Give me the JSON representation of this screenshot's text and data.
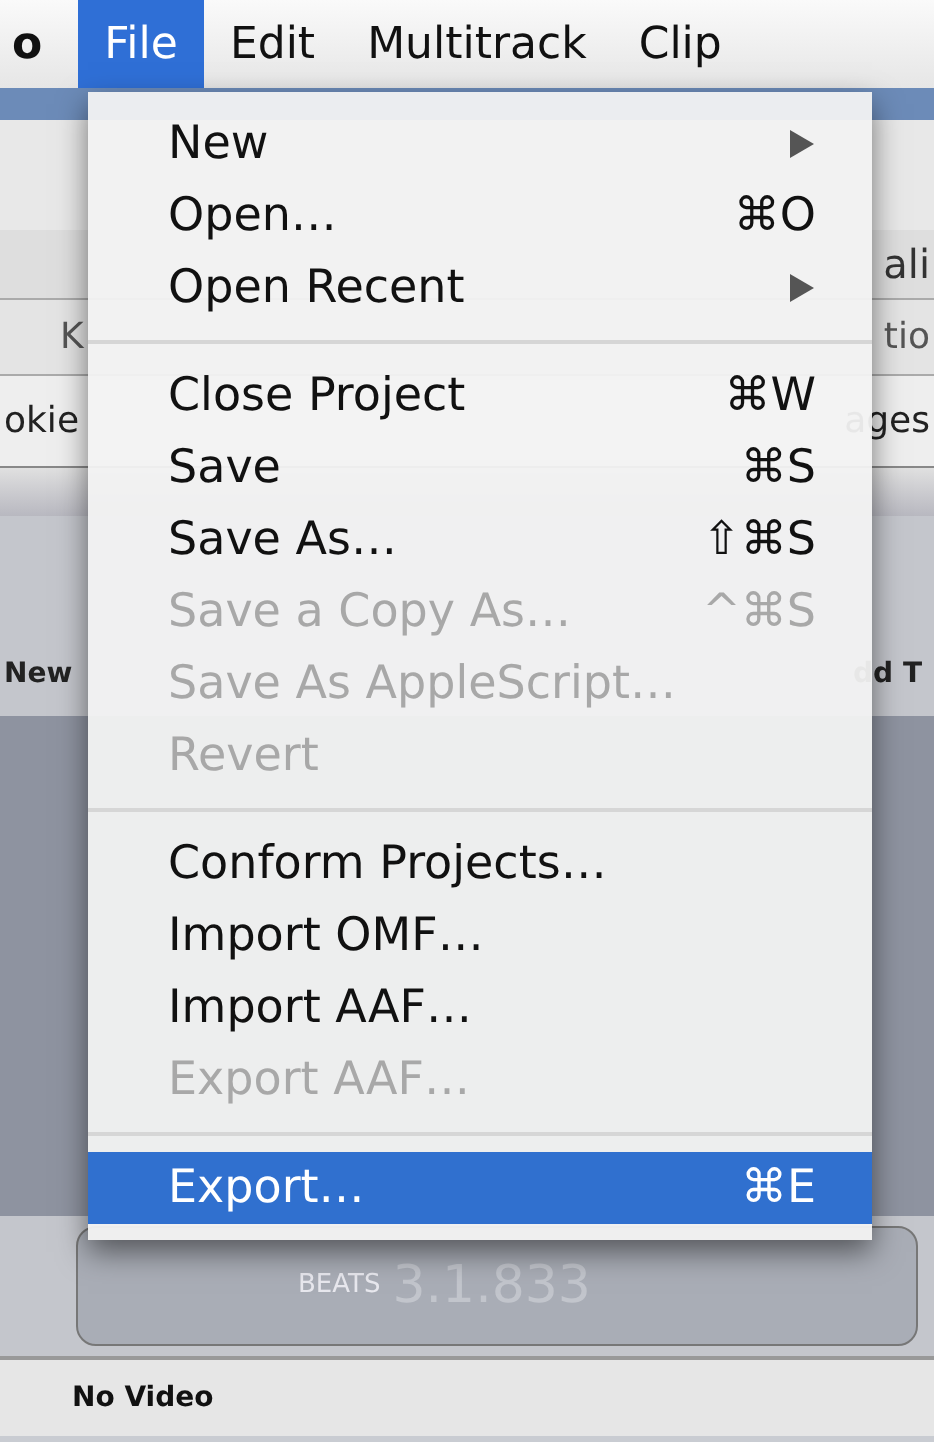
{
  "menu_bar": {
    "items": [
      {
        "label": "o",
        "selected": false
      },
      {
        "label": "File",
        "selected": true
      },
      {
        "label": "Edit",
        "selected": false
      },
      {
        "label": "Multitrack",
        "selected": false
      },
      {
        "label": "Clip",
        "selected": false
      }
    ]
  },
  "file_menu": {
    "items": [
      {
        "kind": "item",
        "label": "New",
        "submenu": true,
        "disabled": false,
        "selected": false
      },
      {
        "kind": "item",
        "label": "Open…",
        "shortcut": "⌘O",
        "submenu": false,
        "disabled": false,
        "selected": false
      },
      {
        "kind": "item",
        "label": "Open Recent",
        "submenu": true,
        "disabled": false,
        "selected": false
      },
      {
        "kind": "separator"
      },
      {
        "kind": "item",
        "label": "Close Project",
        "shortcut": "⌘W",
        "submenu": false,
        "disabled": false,
        "selected": false
      },
      {
        "kind": "item",
        "label": "Save",
        "shortcut": "⌘S",
        "submenu": false,
        "disabled": false,
        "selected": false
      },
      {
        "kind": "item",
        "label": "Save As…",
        "shortcut": "⇧⌘S",
        "submenu": false,
        "disabled": false,
        "selected": false
      },
      {
        "kind": "item",
        "label": "Save a Copy As…",
        "shortcut": "^⌘S",
        "submenu": false,
        "disabled": true,
        "selected": false
      },
      {
        "kind": "item",
        "label": "Save As AppleScript…",
        "submenu": false,
        "disabled": true,
        "selected": false
      },
      {
        "kind": "item",
        "label": "Revert",
        "submenu": false,
        "disabled": true,
        "selected": false
      },
      {
        "kind": "separator"
      },
      {
        "kind": "item",
        "label": "Conform Projects…",
        "submenu": false,
        "disabled": false,
        "selected": false
      },
      {
        "kind": "item",
        "label": "Import OMF…",
        "submenu": false,
        "disabled": false,
        "selected": false
      },
      {
        "kind": "item",
        "label": "Import AAF…",
        "submenu": false,
        "disabled": false,
        "selected": false
      },
      {
        "kind": "item",
        "label": "Export AAF…",
        "submenu": false,
        "disabled": true,
        "selected": false
      },
      {
        "kind": "separator"
      },
      {
        "kind": "item",
        "label": "Export…",
        "shortcut": "⌘E",
        "submenu": false,
        "disabled": false,
        "selected": true
      }
    ]
  },
  "background": {
    "address_right": "ali",
    "bookmarks_left": "K",
    "bookmarks_right": "tio",
    "tabs_left": "okie",
    "tabs_right": "ages",
    "toolbar_left": "New",
    "toolbar_right": "dd T",
    "beats_label": "BEATS",
    "beats_value": "3.1.833",
    "status": "No Video"
  }
}
